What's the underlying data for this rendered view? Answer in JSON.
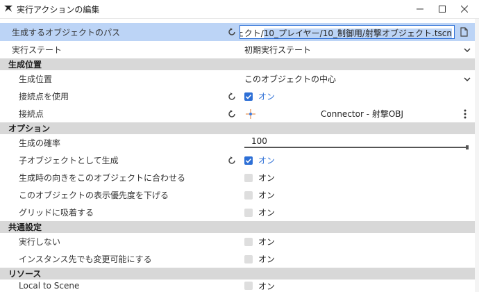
{
  "window": {
    "title": "実行アクションの編集"
  },
  "rows": {
    "path": {
      "label": "生成するオブジェクトのパス",
      "value_plain": "プジェクト/",
      "value_selected": "10_プレイヤー/10_制御用/射撃オブジェクト.tscn"
    },
    "state": {
      "label": "実行ステート",
      "value": "初期実行ステート"
    },
    "sec_pos": {
      "label": "生成位置"
    },
    "gen_pos": {
      "label": "生成位置",
      "value": "このオブジェクトの中心"
    },
    "use_connector": {
      "label": "接続点を使用",
      "value": "オン",
      "checked": true
    },
    "connector": {
      "label": "接続点",
      "value": "Connector - 射撃OBJ"
    },
    "sec_opt": {
      "label": "オプション"
    },
    "prob": {
      "label": "生成の確率",
      "value": "100",
      "fraction": 1.0
    },
    "as_child": {
      "label": "子オブジェクトとして生成",
      "value": "オン",
      "checked": true
    },
    "match_dir": {
      "label": "生成時の向きをこのオブジェクトに合わせる",
      "value": "オン",
      "checked": false
    },
    "lower_prio": {
      "label": "このオブジェクトの表示優先度を下げる",
      "value": "オン",
      "checked": false
    },
    "snap_grid": {
      "label": "グリッドに吸着する",
      "value": "オン",
      "checked": false
    },
    "sec_common": {
      "label": "共通設定"
    },
    "no_exec": {
      "label": "実行しない",
      "value": "オン",
      "checked": false
    },
    "instance_edit": {
      "label": "インスタンス先でも変更可能にする",
      "value": "オン",
      "checked": false
    },
    "sec_res": {
      "label": "リソース"
    },
    "local_scene": {
      "label": "Local to Scene",
      "value": "オン",
      "checked": false
    }
  },
  "colors": {
    "accent": "#2d6fd6",
    "section_bg": "#d8d8d8",
    "selected_row": "#bcd4f6"
  }
}
